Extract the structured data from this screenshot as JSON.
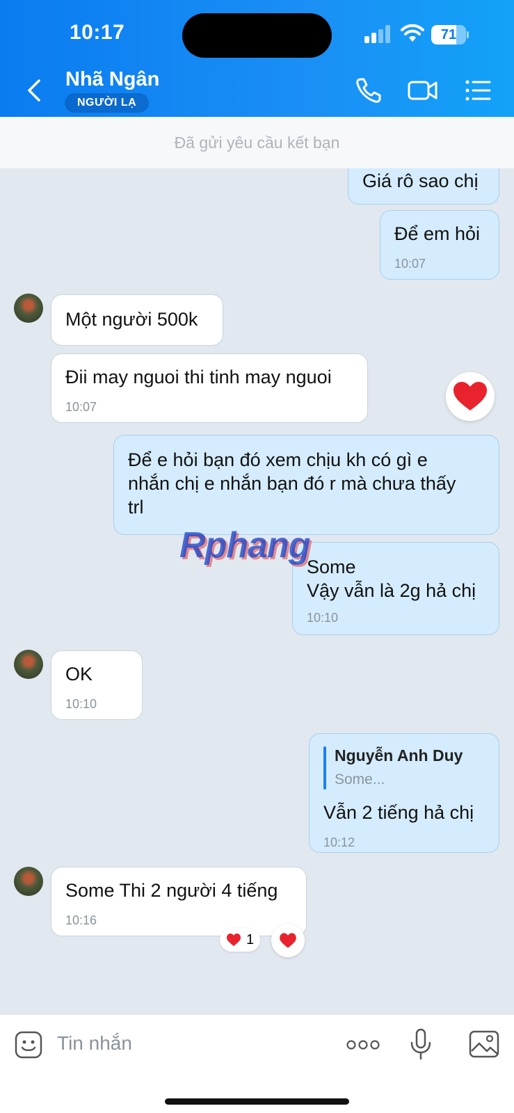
{
  "status_bar": {
    "time": "10:17",
    "battery": "71",
    "battery_level": 0.71
  },
  "header": {
    "contact_name": "Nhã Ngân",
    "badge": "NGƯỜI LẠ"
  },
  "friend_request_bar": {
    "text": "Đã gửi yêu cầu kết bạn"
  },
  "messages": [
    {
      "direction": "out",
      "text": "Giá rô sao chị",
      "time": ""
    },
    {
      "direction": "out",
      "text": "Để em hỏi",
      "time": "10:07"
    },
    {
      "direction": "in",
      "text": "Một người 500k",
      "time": ""
    },
    {
      "direction": "in",
      "text": "Đii may nguoi thi tinh may nguoi",
      "time": "10:07",
      "reaction": "heart"
    },
    {
      "direction": "out",
      "text": "Để e hỏi bạn đó xem chịu kh có gì e\nnhắn chị e nhắn bạn đó r mà chưa thấy\ntrl",
      "time": ""
    },
    {
      "direction": "out",
      "text": "Some\nVậy vẫn là 2g hả chị",
      "time": "10:10"
    },
    {
      "direction": "in",
      "text": "OK",
      "time": "10:10"
    },
    {
      "direction": "out",
      "reply_to_name": "Nguyễn Anh Duy",
      "reply_to_snippet": "Some...",
      "text": "Vẫn 2 tiếng hả chị",
      "time": "10:12"
    },
    {
      "direction": "in",
      "text": "Some Thi 2 người 4 tiếng",
      "time": "10:16",
      "reaction_count": "1"
    }
  ],
  "watermark": "Rphang",
  "input": {
    "placeholder": "Tin nhắn"
  },
  "colors": {
    "header": "#0a7cf0",
    "outgoing_bubble": "#d4ecfd",
    "incoming_bubble": "#ffffff",
    "chat_bg": "#e2e8ef"
  }
}
